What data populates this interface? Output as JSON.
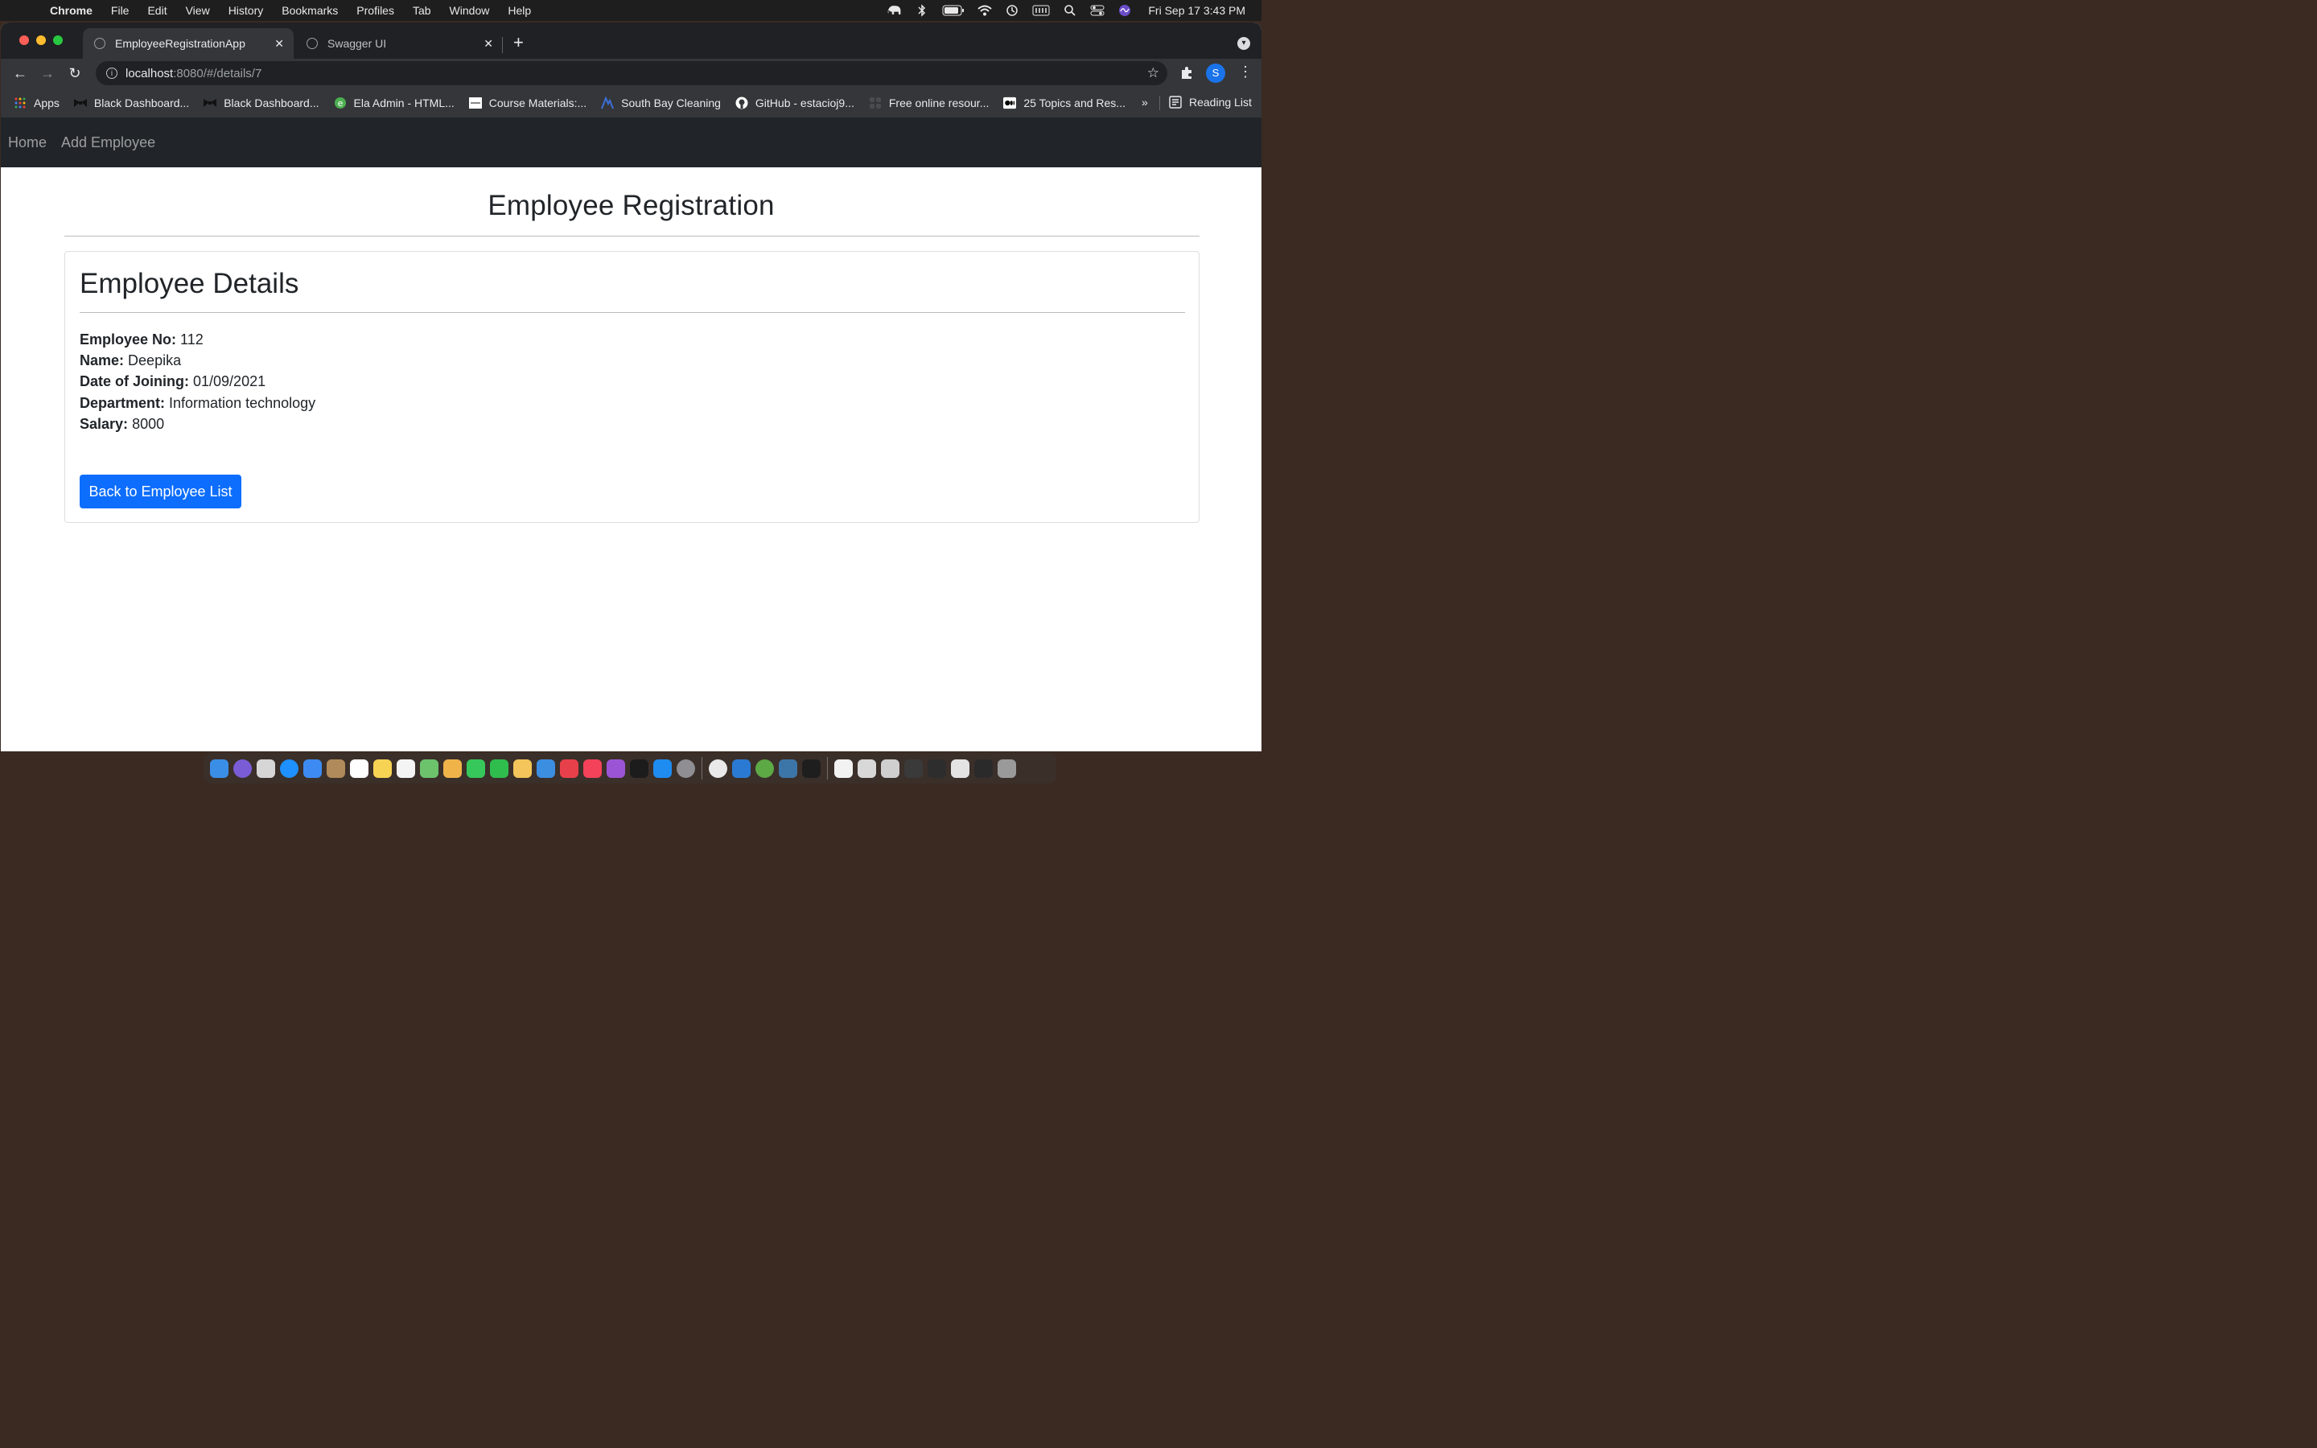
{
  "menubar": {
    "app_name": "Chrome",
    "items": [
      "File",
      "Edit",
      "View",
      "History",
      "Bookmarks",
      "Profiles",
      "Tab",
      "Window",
      "Help"
    ],
    "clock": "Fri Sep 17  3:43 PM"
  },
  "tabs": [
    {
      "title": "EmployeeRegistrationApp",
      "active": true
    },
    {
      "title": "Swagger UI",
      "active": false
    }
  ],
  "address_bar": {
    "host": "localhost",
    "path": ":8080/#/details/7"
  },
  "profile_initial": "S",
  "bookmarks": [
    {
      "label": "Apps",
      "icon": "apps-grid-icon"
    },
    {
      "label": "Black Dashboard...",
      "icon": "bowtie-icon"
    },
    {
      "label": "Black Dashboard...",
      "icon": "bowtie-icon"
    },
    {
      "label": "Ela Admin - HTML...",
      "icon": "ela-icon"
    },
    {
      "label": "Course Materials:...",
      "icon": "course-icon"
    },
    {
      "label": "South Bay Cleaning",
      "icon": "southbay-icon"
    },
    {
      "label": "GitHub - estacioj9...",
      "icon": "github-icon"
    },
    {
      "label": "Free online resour...",
      "icon": "resource-icon"
    },
    {
      "label": "25 Topics and Res...",
      "icon": "medium-icon"
    }
  ],
  "bookmarks_overflow": "»",
  "reading_list": "Reading List",
  "nav": {
    "home": "Home",
    "add": "Add Employee"
  },
  "page": {
    "title": "Employee Registration",
    "card_title": "Employee Details",
    "fields": [
      {
        "label": "Employee No:",
        "value": "112"
      },
      {
        "label": "Name:",
        "value": "Deepika"
      },
      {
        "label": "Date of Joining:",
        "value": "01/09/2021"
      },
      {
        "label": "Department:",
        "value": "Information technology"
      },
      {
        "label": "Salary:",
        "value": "8000"
      }
    ],
    "back_button": "Back to Employee List"
  },
  "colors": {
    "primary": "#0d6efd",
    "navbar": "#212529"
  }
}
